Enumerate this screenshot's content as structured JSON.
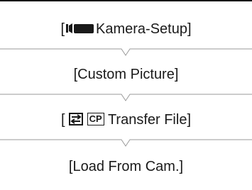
{
  "steps": [
    {
      "bracket_open": "[",
      "icon": "camera-mode-icon",
      "label": "Kamera-Setup",
      "bracket_close": "]"
    },
    {
      "text": "[Custom Picture]"
    },
    {
      "bracket_open": "[",
      "icons": [
        "transfer-icon",
        "cp-icon"
      ],
      "cp_text": "CP",
      "label": "Transfer File",
      "bracket_close": "]"
    },
    {
      "text": "[Load From Cam.]"
    }
  ],
  "colors": {
    "text": "#1a1a1a",
    "rule": "#111111",
    "separator": "#9a9a9a"
  }
}
